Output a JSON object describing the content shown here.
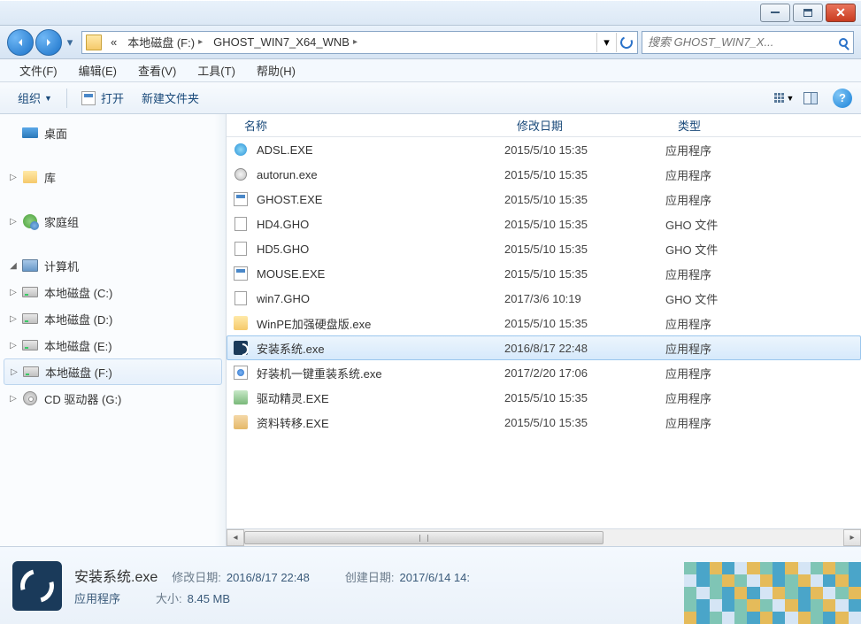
{
  "titlebar": {
    "min": "—",
    "max": "▢",
    "close": "✕"
  },
  "nav": {
    "breadcrumb_prefix": "«",
    "breadcrumb": [
      "本地磁盘 (F:)",
      "GHOST_WIN7_X64_WNB"
    ],
    "search_placeholder": "搜索 GHOST_WIN7_X..."
  },
  "menus": [
    "文件(F)",
    "编辑(E)",
    "查看(V)",
    "工具(T)",
    "帮助(H)"
  ],
  "toolbar": {
    "organize": "组织",
    "open": "打开",
    "new_folder": "新建文件夹"
  },
  "sidebar": {
    "desktop": "桌面",
    "libraries": "库",
    "homegroup": "家庭组",
    "computer": "计算机",
    "drive_c": "本地磁盘 (C:)",
    "drive_d": "本地磁盘 (D:)",
    "drive_e": "本地磁盘 (E:)",
    "drive_f": "本地磁盘 (F:)",
    "cd": "CD 驱动器 (G:)"
  },
  "columns": {
    "name": "名称",
    "date": "修改日期",
    "type": "类型"
  },
  "files": [
    {
      "icon": "globe",
      "name": "ADSL.EXE",
      "date": "2015/5/10 15:35",
      "type": "应用程序"
    },
    {
      "icon": "cd",
      "name": "autorun.exe",
      "date": "2015/5/10 15:35",
      "type": "应用程序"
    },
    {
      "icon": "exe",
      "name": "GHOST.EXE",
      "date": "2015/5/10 15:35",
      "type": "应用程序"
    },
    {
      "icon": "page",
      "name": "HD4.GHO",
      "date": "2015/5/10 15:35",
      "type": "GHO 文件"
    },
    {
      "icon": "page",
      "name": "HD5.GHO",
      "date": "2015/5/10 15:35",
      "type": "GHO 文件"
    },
    {
      "icon": "exe",
      "name": "MOUSE.EXE",
      "date": "2015/5/10 15:35",
      "type": "应用程序"
    },
    {
      "icon": "page",
      "name": "win7.GHO",
      "date": "2017/3/6 10:19",
      "type": "GHO 文件"
    },
    {
      "icon": "winpe",
      "name": "WinPE加强硬盘版.exe",
      "date": "2015/5/10 15:35",
      "type": "应用程序"
    },
    {
      "icon": "install",
      "name": "安装系统.exe",
      "date": "2016/8/17 22:48",
      "type": "应用程序",
      "selected": true
    },
    {
      "icon": "blue",
      "name": "好装机一键重装系统.exe",
      "date": "2017/2/20 17:06",
      "type": "应用程序"
    },
    {
      "icon": "driver",
      "name": "驱动精灵.EXE",
      "date": "2015/5/10 15:35",
      "type": "应用程序"
    },
    {
      "icon": "data",
      "name": "资料转移.EXE",
      "date": "2015/5/10 15:35",
      "type": "应用程序"
    }
  ],
  "details": {
    "filename": "安装系统.exe",
    "filetype": "应用程序",
    "modified_label": "修改日期:",
    "modified_value": "2016/8/17 22:48",
    "size_label": "大小:",
    "size_value": "8.45 MB",
    "created_label": "创建日期:",
    "created_value": "2017/6/14 14:"
  }
}
